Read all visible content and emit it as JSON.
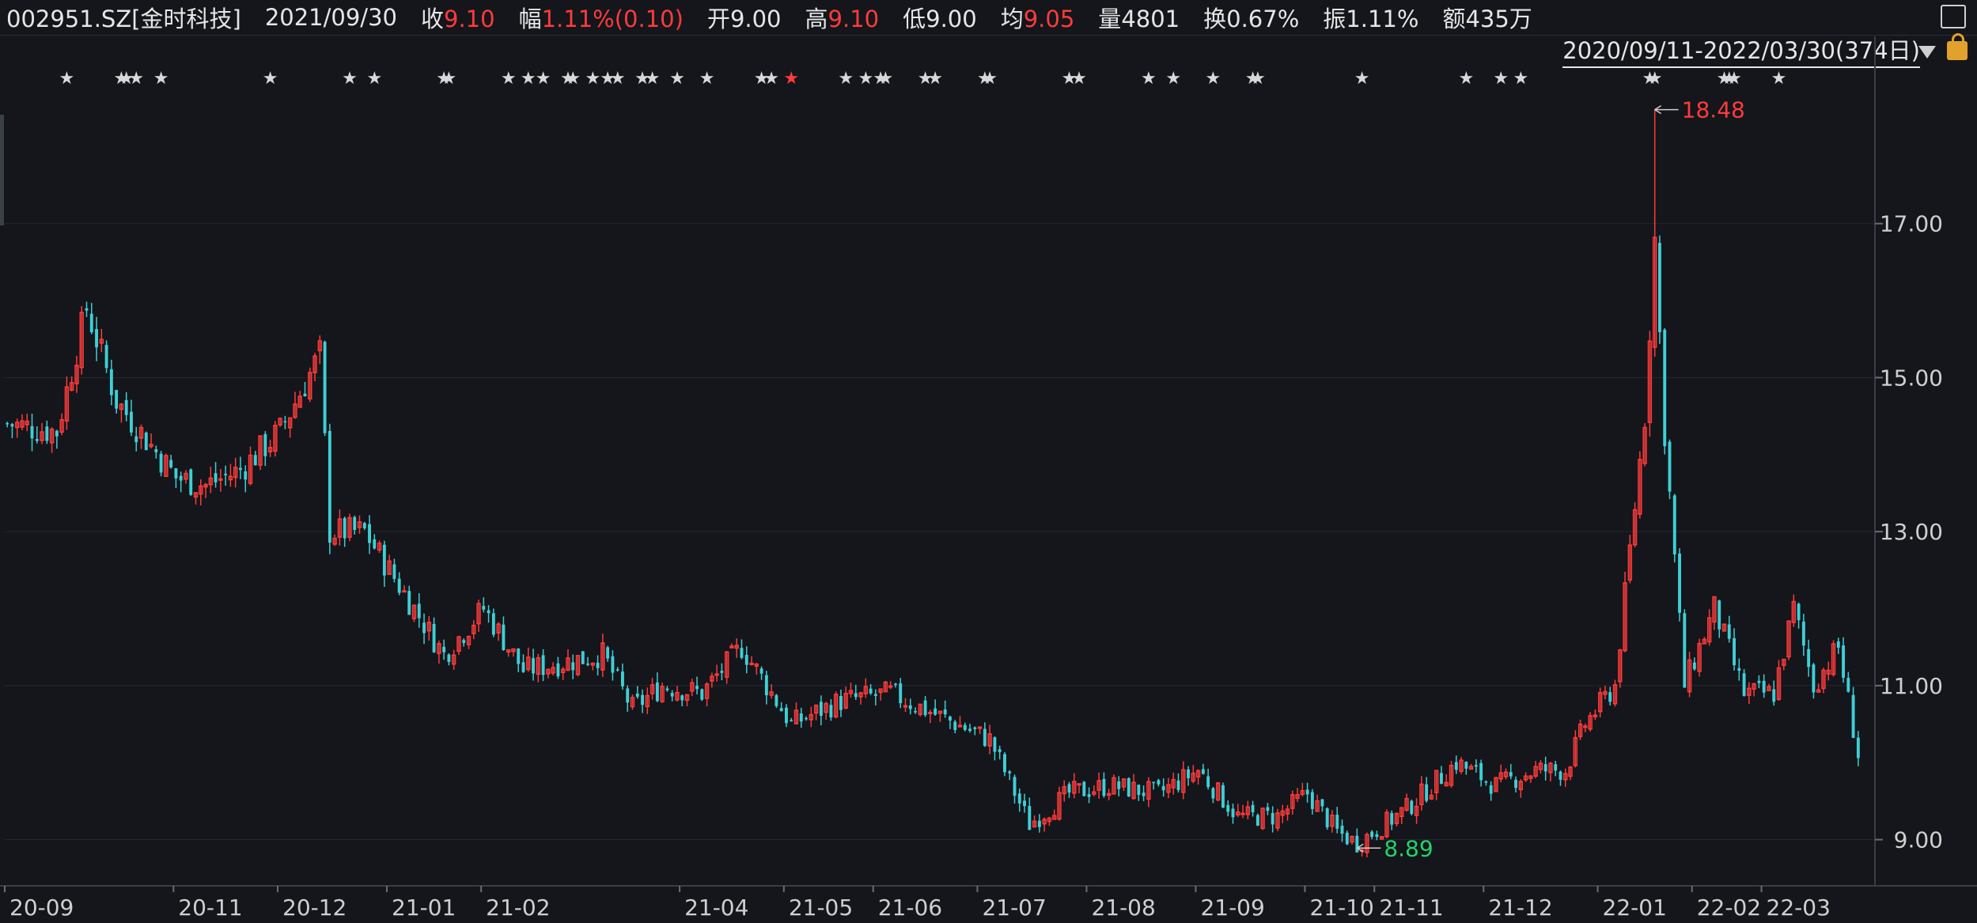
{
  "header": {
    "symbol": "002951.SZ[金时科技]",
    "date": "2021/09/30",
    "close_label": "收",
    "close_value": "9.10",
    "change_label": "幅",
    "change_value": "1.11%(0.10)",
    "open_label": "开",
    "open_value": "9.00",
    "high_label": "高",
    "high_value": "9.10",
    "low_label": "低",
    "low_value": "9.00",
    "avg_label": "均",
    "avg_value": "9.05",
    "volume_label": "量",
    "volume_value": "4801",
    "turnover_label": "换",
    "turnover_value": "0.67%",
    "amplitude_label": "振",
    "amplitude_value": "1.11%",
    "amount_label": "额",
    "amount_value": "435万"
  },
  "range_label": "2020/09/11-2022/03/30(374日)",
  "colors": {
    "background": "#14161b",
    "up": "#ff3b3b",
    "down": "#3ecfd6",
    "grid": "#252830",
    "star": "#d8d8d8",
    "star_highlight": "#ff3b3b",
    "high_marker": "#ff3b3b",
    "low_marker": "#22d36a"
  },
  "icons": [
    "fullscreen-icon",
    "dropdown-arrow-icon",
    "lock-icon"
  ],
  "chart_data": {
    "type": "candlestick",
    "x_tick_labels": [
      "20-09",
      "20-11",
      "20-12",
      "21-01",
      "21-02",
      "21-04",
      "21-05",
      "21-06",
      "21-07",
      "21-08",
      "21-09",
      "21-10",
      "21-11",
      "21-12",
      "22-01",
      "22-02",
      "22-03"
    ],
    "y_tick_labels": [
      "17.00",
      "15.00",
      "13.00",
      "11.00",
      "9.00"
    ],
    "ylim": [
      8.4,
      19.0
    ],
    "annotations": [
      {
        "text": "18.48",
        "type": "max",
        "value": 18.48
      },
      {
        "text": "8.89",
        "type": "min",
        "value": 8.89
      }
    ],
    "month_index_ranges": [
      {
        "label": "20-09",
        "start": 0
      },
      {
        "label": "20-11",
        "start": 34
      },
      {
        "label": "20-12",
        "start": 55
      },
      {
        "label": "21-01",
        "start": 77
      },
      {
        "label": "21-02",
        "start": 96
      },
      {
        "label": "21-04",
        "start": 136
      },
      {
        "label": "21-05",
        "start": 157
      },
      {
        "label": "21-06",
        "start": 175
      },
      {
        "label": "21-07",
        "start": 196
      },
      {
        "label": "21-08",
        "start": 218
      },
      {
        "label": "21-09",
        "start": 240
      },
      {
        "label": "21-10",
        "start": 262
      },
      {
        "label": "21-11",
        "start": 276
      },
      {
        "label": "21-12",
        "start": 298
      },
      {
        "label": "22-01",
        "start": 321
      },
      {
        "label": "22-02",
        "start": 340
      },
      {
        "label": "22-03",
        "start": 354
      }
    ],
    "close_waypoints": [
      [
        0,
        14.4
      ],
      [
        10,
        14.3
      ],
      [
        16,
        15.9
      ],
      [
        22,
        14.7
      ],
      [
        34,
        13.7
      ],
      [
        40,
        13.6
      ],
      [
        47,
        13.8
      ],
      [
        55,
        14.3
      ],
      [
        63,
        15.3
      ],
      [
        65,
        13.0
      ],
      [
        72,
        13.0
      ],
      [
        80,
        12.2
      ],
      [
        88,
        11.4
      ],
      [
        96,
        12.0
      ],
      [
        104,
        11.2
      ],
      [
        112,
        11.3
      ],
      [
        120,
        11.4
      ],
      [
        126,
        10.7
      ],
      [
        132,
        11.0
      ],
      [
        140,
        10.9
      ],
      [
        148,
        11.5
      ],
      [
        158,
        10.5
      ],
      [
        168,
        10.8
      ],
      [
        178,
        10.9
      ],
      [
        188,
        10.6
      ],
      [
        198,
        10.3
      ],
      [
        206,
        9.2
      ],
      [
        214,
        9.6
      ],
      [
        222,
        9.7
      ],
      [
        232,
        9.6
      ],
      [
        240,
        9.9
      ],
      [
        248,
        9.3
      ],
      [
        256,
        9.3
      ],
      [
        262,
        9.6
      ],
      [
        268,
        9.1
      ],
      [
        272,
        8.95
      ],
      [
        282,
        9.4
      ],
      [
        292,
        10.0
      ],
      [
        300,
        9.7
      ],
      [
        308,
        9.9
      ],
      [
        314,
        9.9
      ],
      [
        318,
        10.5
      ],
      [
        324,
        11.0
      ],
      [
        330,
        14.5
      ],
      [
        332,
        16.8
      ],
      [
        334,
        14.3
      ],
      [
        338,
        11.0
      ],
      [
        344,
        12.0
      ],
      [
        350,
        10.9
      ],
      [
        356,
        10.9
      ],
      [
        360,
        12.0
      ],
      [
        364,
        11.0
      ],
      [
        369,
        11.5
      ],
      [
        373,
        10.1
      ]
    ],
    "stars": [
      {
        "index": 12
      },
      {
        "index": 23
      },
      {
        "index": 24
      },
      {
        "index": 26
      },
      {
        "index": 31
      },
      {
        "index": 53
      },
      {
        "index": 69
      },
      {
        "index": 74
      },
      {
        "index": 88
      },
      {
        "index": 89
      },
      {
        "index": 101
      },
      {
        "index": 105
      },
      {
        "index": 108
      },
      {
        "index": 113
      },
      {
        "index": 114
      },
      {
        "index": 118
      },
      {
        "index": 121
      },
      {
        "index": 123
      },
      {
        "index": 128
      },
      {
        "index": 130
      },
      {
        "index": 135
      },
      {
        "index": 141
      },
      {
        "index": 152
      },
      {
        "index": 154
      },
      {
        "index": 158,
        "highlight": true
      },
      {
        "index": 169
      },
      {
        "index": 173
      },
      {
        "index": 176
      },
      {
        "index": 177
      },
      {
        "index": 185
      },
      {
        "index": 187
      },
      {
        "index": 197
      },
      {
        "index": 198
      },
      {
        "index": 214
      },
      {
        "index": 216
      },
      {
        "index": 230
      },
      {
        "index": 235
      },
      {
        "index": 243
      },
      {
        "index": 251
      },
      {
        "index": 252
      },
      {
        "index": 273
      },
      {
        "index": 294
      },
      {
        "index": 301
      },
      {
        "index": 305
      },
      {
        "index": 331
      },
      {
        "index": 332
      },
      {
        "index": 346
      },
      {
        "index": 347
      },
      {
        "index": 348
      },
      {
        "index": 357
      }
    ]
  }
}
